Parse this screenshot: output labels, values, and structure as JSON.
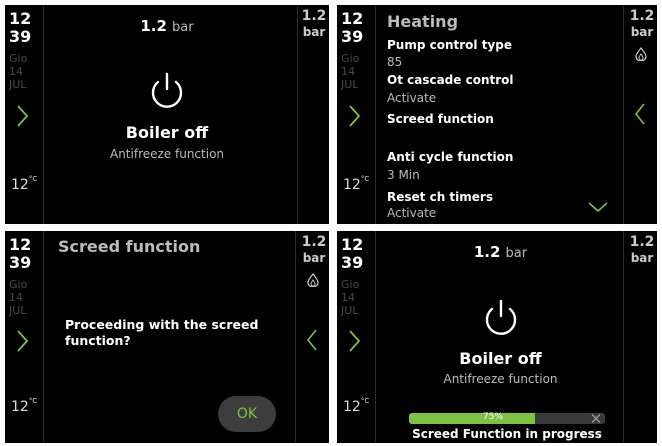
{
  "colors": {
    "accent": "#7ec241",
    "background": "#000000",
    "muted": "#4a4a4a"
  },
  "sidebar": {
    "hour": "12",
    "minute": "39",
    "day_name": "Gio",
    "day_num": "14",
    "month": "JUL",
    "temp": "12",
    "temp_unit": "°C"
  },
  "pressure": {
    "value": "1.2",
    "unit": "bar"
  },
  "status": {
    "title": "Boiler off",
    "subtitle": "Antifreeze function"
  },
  "heating_menu": {
    "title": "Heating",
    "items": [
      {
        "label": "Pump control type",
        "value": "85"
      },
      {
        "label": "Ot cascade control",
        "value": "Activate"
      },
      {
        "label": "Screed function",
        "value": ""
      },
      {
        "label": "Anti cycle function",
        "value": "3 Min"
      },
      {
        "label": "Reset ch timers",
        "value": "Activate"
      }
    ]
  },
  "screed_dialog": {
    "title": "Screed function",
    "question": "Proceeding with the screed function?",
    "ok_label": "OK"
  },
  "progress": {
    "percent_label": "75%",
    "fraction": 0.75,
    "label": "Screed Function in progress"
  },
  "icons": {
    "flame": "flame-icon",
    "power": "power-icon",
    "next": "chevron-right-icon",
    "back": "chevron-left-icon",
    "down": "chevron-down-icon",
    "cancel": "close-icon"
  }
}
